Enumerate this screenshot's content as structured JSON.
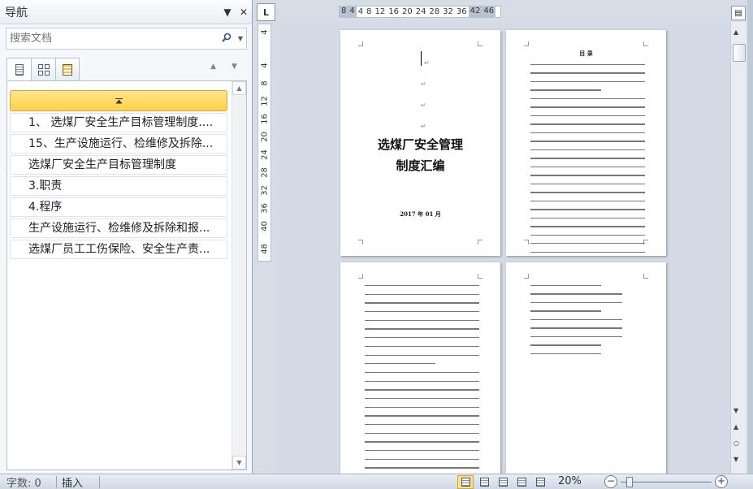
{
  "nav": {
    "title": "导航",
    "dropdown_glyph": "▼",
    "close_glyph": "✕",
    "search_placeholder": "搜索文档",
    "outline": [
      {
        "label": "1、 选煤厂安全生产目标管理制度...."
      },
      {
        "label": "15、生产设施运行、检维修及拆除..."
      },
      {
        "label": "选煤厂安全生产目标管理制度"
      },
      {
        "label": "3.职责"
      },
      {
        "label": "4.程序"
      },
      {
        "label": "生产设施运行、检维修及拆除和报..."
      },
      {
        "label": "选煤厂员工工伤保险、安全生产责..."
      }
    ]
  },
  "ruler": {
    "corner_glyph": "L",
    "h_ticks": [
      "8",
      "4",
      "4",
      "8",
      "12",
      "16",
      "20",
      "24",
      "28",
      "32",
      "36",
      "42",
      "46"
    ],
    "v_ticks": [
      "4",
      "4",
      "8",
      "12",
      "16",
      "20",
      "24",
      "28",
      "32",
      "36",
      "40",
      "48"
    ]
  },
  "document": {
    "cover_title_line1": "选煤厂安全管理",
    "cover_title_line2": "制度汇编",
    "cover_date": "2017 年 01 月",
    "toc_title": "目  录"
  },
  "status": {
    "words": "字数: 0",
    "insert_mode": "插入",
    "zoom": "20%",
    "zoom_fraction": 0.07
  }
}
